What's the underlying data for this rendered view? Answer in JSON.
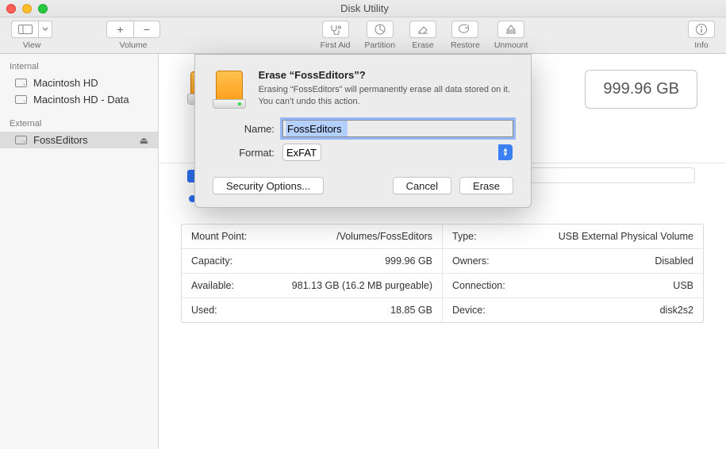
{
  "window": {
    "title": "Disk Utility"
  },
  "toolbar": {
    "view": "View",
    "volume": "Volume",
    "first_aid": "First Aid",
    "partition": "Partition",
    "erase": "Erase",
    "restore": "Restore",
    "unmount": "Unmount",
    "info": "Info"
  },
  "sidebar": {
    "internal_header": "Internal",
    "external_header": "External",
    "internal": [
      {
        "label": "Macintosh HD"
      },
      {
        "label": "Macintosh HD - Data"
      }
    ],
    "external": [
      {
        "label": "FossEditors"
      }
    ]
  },
  "header": {
    "capacity": "999.96 GB"
  },
  "dialog": {
    "title": "Erase “FossEditors”?",
    "message": "Erasing “FossEditors” will permanently erase all data stored on it. You can’t undo this action.",
    "name_label": "Name:",
    "name_value": "FossEditors",
    "format_label": "Format:",
    "format_value": "ExFAT",
    "security_options": "Security Options...",
    "cancel": "Cancel",
    "erase": "Erase"
  },
  "info": {
    "rows": [
      {
        "l": "Mount Point:",
        "lv": "/Volumes/FossEditors",
        "r": "Type:",
        "rv": "USB External Physical Volume"
      },
      {
        "l": "Capacity:",
        "lv": "999.96 GB",
        "r": "Owners:",
        "rv": "Disabled"
      },
      {
        "l": "Available:",
        "lv": "981.13 GB (16.2 MB purgeable)",
        "r": "Connection:",
        "rv": "USB"
      },
      {
        "l": "Used:",
        "lv": "18.85 GB",
        "r": "Device:",
        "rv": "disk2s2"
      }
    ]
  }
}
